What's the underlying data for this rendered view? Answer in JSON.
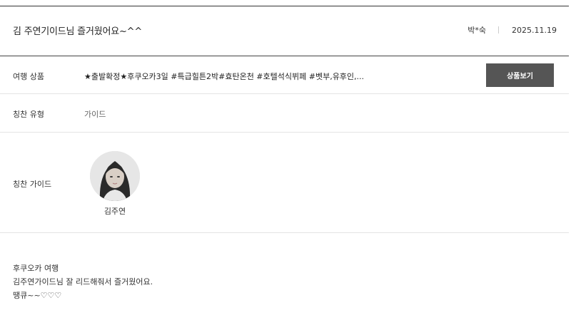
{
  "review": {
    "title": "김 주연기이드님 즐거웠어요~^^",
    "author": "박*숙",
    "date": "2025.11.19"
  },
  "rows": {
    "product": {
      "label": "여행 상품",
      "value": "★출발확정★후쿠오카3일 #특급힐튼2박#효탄온천 #호텔석식뷔페 #벳부,유후인,...",
      "button_label": "상품보기"
    },
    "praise_type": {
      "label": "칭찬 유형",
      "value": "가이드"
    },
    "praise_guide": {
      "label": "칭찬 가이드",
      "guide_name": "김주연"
    }
  },
  "content": {
    "lines": [
      "후쿠오카 여행",
      "김주연가이드님 잘 리드해줘서 즐거웠어요.",
      "땡큐~~♡♡♡"
    ]
  },
  "colors": {
    "button_bg": "#555555",
    "rule_dark": "#444444",
    "rule_light": "#e4e4e4"
  },
  "icons": {
    "avatar": "guide-portrait-photo"
  }
}
